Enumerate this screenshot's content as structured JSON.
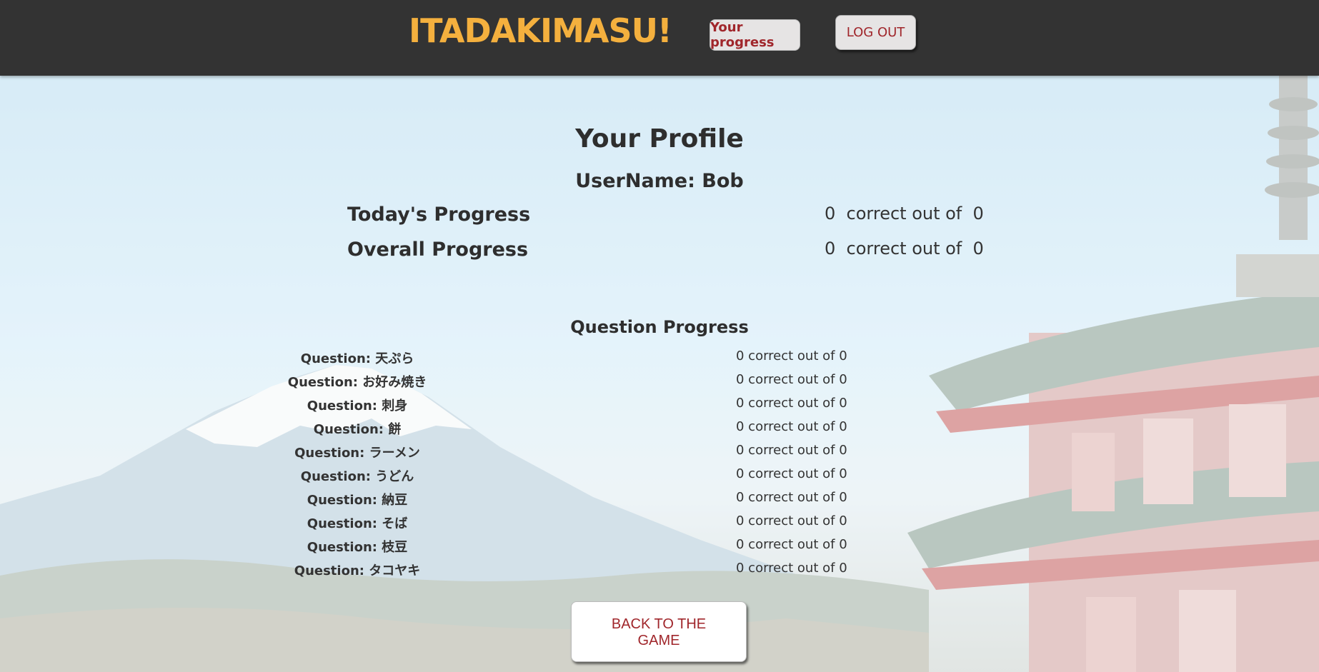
{
  "header": {
    "brand": "ITADAKIMASU!",
    "progress_button": "Your progress",
    "logout_button": "LOG OUT"
  },
  "profile": {
    "title": "Your Profile",
    "username": "UserName: Bob",
    "today": {
      "label": "Today's Progress",
      "value": "0  correct out of  0"
    },
    "overall": {
      "label": "Overall Progress",
      "value": "0  correct out of  0"
    }
  },
  "questions": {
    "title": "Question Progress",
    "items": [
      {
        "label": "Question: 天ぷら",
        "value": "0 correct out of 0"
      },
      {
        "label": "Question: お好み焼き",
        "value": "0 correct out of 0"
      },
      {
        "label": "Question: 刺身",
        "value": "0 correct out of 0"
      },
      {
        "label": "Question: 餅",
        "value": "0 correct out of 0"
      },
      {
        "label": "Question: ラーメン",
        "value": "0 correct out of 0"
      },
      {
        "label": "Question: うどん",
        "value": "0 correct out of 0"
      },
      {
        "label": "Question: 納豆",
        "value": "0 correct out of 0"
      },
      {
        "label": "Question: そば",
        "value": "0 correct out of 0"
      },
      {
        "label": "Question: 枝豆",
        "value": "0 correct out of 0"
      },
      {
        "label": "Question: タコヤキ",
        "value": "0 correct out of 0"
      }
    ]
  },
  "back_button": "BACK TO THE GAME",
  "colors": {
    "header_bg": "#333333",
    "brand": "#f4b03e",
    "button_text": "#a0262b"
  }
}
